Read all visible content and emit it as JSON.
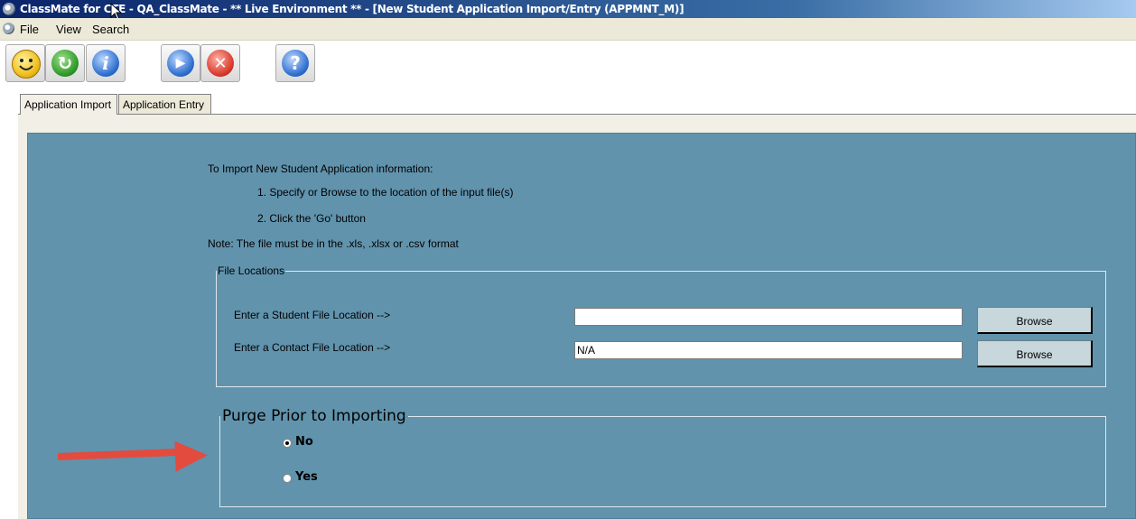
{
  "window": {
    "title": "ClassMate for CTE - QA_ClassMate - ** Live Environment ** - [New Student Application Import/Entry (APPMNT_M)]"
  },
  "menu": {
    "items": [
      {
        "label": "File"
      },
      {
        "label": "View"
      },
      {
        "label": "Search"
      }
    ]
  },
  "toolbar": {
    "buttons": [
      {
        "icon": "smiley-face-icon"
      },
      {
        "icon": "refresh-icon"
      },
      {
        "icon": "info-icon"
      },
      {
        "icon": "play-icon"
      },
      {
        "icon": "close-icon"
      },
      {
        "icon": "help-icon"
      }
    ]
  },
  "tabs": [
    {
      "label": "Application Import",
      "active": true
    },
    {
      "label": "Application Entry",
      "active": false
    }
  ],
  "instructions": {
    "heading": "To Import New Student Application information:",
    "step1": "1.  Specify or Browse to the location of the input file(s)",
    "step2": "2.  Click the 'Go' button",
    "note": "Note:  The file must be in the .xls, .xlsx or .csv format"
  },
  "file_locations": {
    "legend": "File Locations",
    "student_label": "Enter a Student File Location -->",
    "student_value": "",
    "contact_label": "Enter a Contact File Location -->",
    "contact_value": "N/A",
    "browse_label": "Browse"
  },
  "purge": {
    "legend": "Purge Prior to Importing",
    "options": [
      {
        "label": "No",
        "selected": true
      },
      {
        "label": "Yes",
        "selected": false
      }
    ]
  },
  "colors": {
    "panel": "#6193ad",
    "annotation_arrow": "#e34b3f"
  }
}
